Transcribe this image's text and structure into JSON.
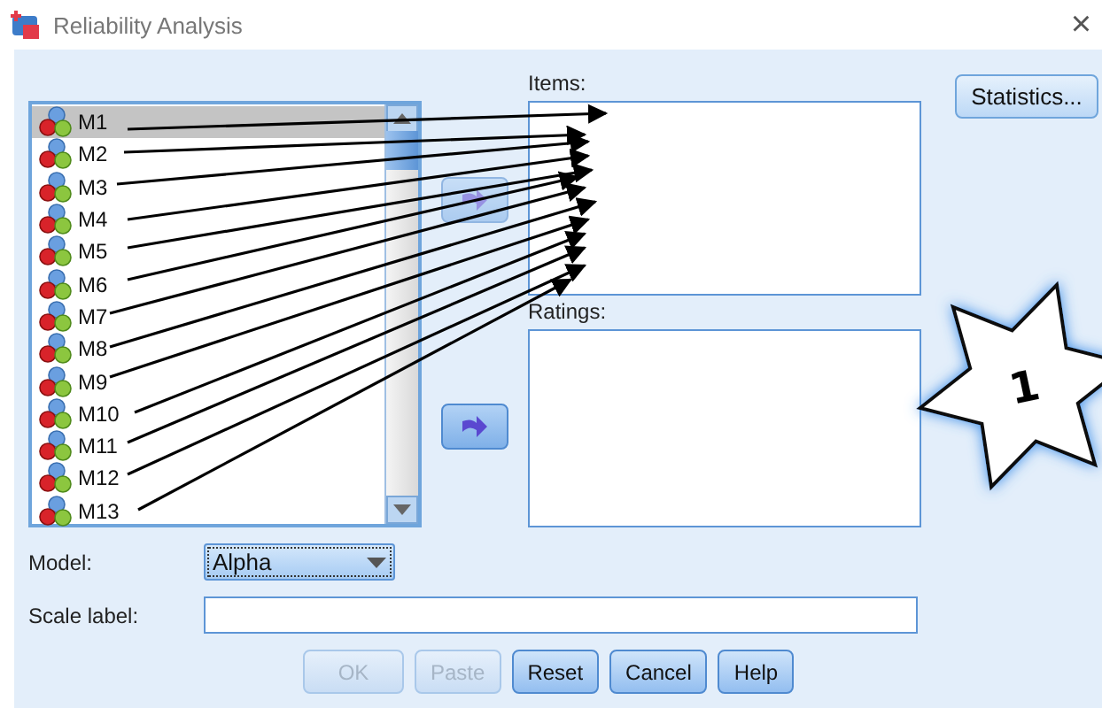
{
  "window": {
    "title": "Reliability Analysis",
    "close": "×"
  },
  "variables": [
    {
      "name": "M1",
      "selected": true
    },
    {
      "name": "M2",
      "selected": false
    },
    {
      "name": "M3",
      "selected": false
    },
    {
      "name": "M4",
      "selected": false
    },
    {
      "name": "M5",
      "selected": false
    },
    {
      "name": "M6",
      "selected": false
    },
    {
      "name": "M7",
      "selected": false
    },
    {
      "name": "M8",
      "selected": false
    },
    {
      "name": "M9",
      "selected": false
    },
    {
      "name": "M10",
      "selected": false
    },
    {
      "name": "M11",
      "selected": false
    },
    {
      "name": "M12",
      "selected": false
    },
    {
      "name": "M13",
      "selected": false
    }
  ],
  "transfer_buttons": [
    {
      "disabled": true
    },
    {
      "disabled": false
    }
  ],
  "targets": [
    {
      "label": "Items:"
    },
    {
      "label": "Ratings:"
    }
  ],
  "statistics_button": "Statistics...",
  "model": {
    "label": "Model:",
    "value": "Alpha"
  },
  "scale_label": {
    "label": "Scale label:"
  },
  "buttons": [
    {
      "label": "OK",
      "disabled": true
    },
    {
      "label": "Paste",
      "disabled": true
    },
    {
      "label": "Reset",
      "disabled": false
    },
    {
      "label": "Cancel",
      "disabled": false
    },
    {
      "label": "Help",
      "disabled": false
    }
  ],
  "callout": {
    "label": "1"
  }
}
